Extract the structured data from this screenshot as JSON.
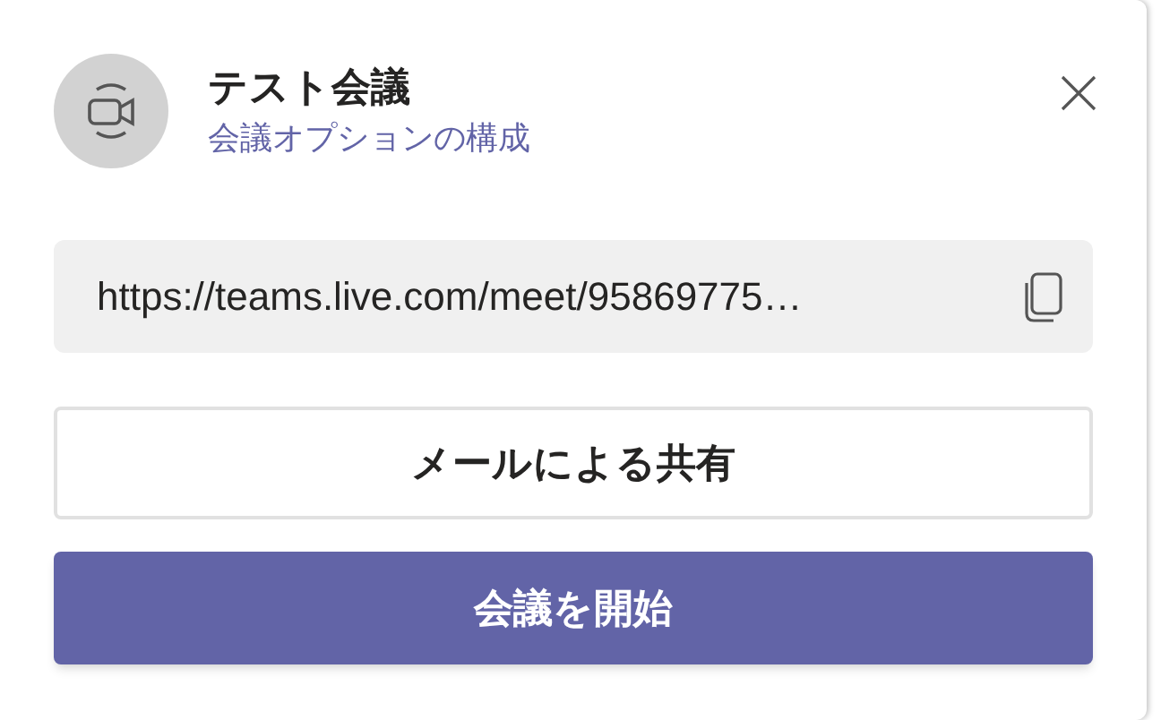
{
  "dialog": {
    "title": "テスト会議",
    "subtitle": "会議オプションの構成"
  },
  "link": {
    "value": "https://teams.live.com/meet/95869775…"
  },
  "buttons": [
    {
      "label": "メールによる共有",
      "kind": "secondary"
    },
    {
      "label": "会議を開始",
      "kind": "primary"
    }
  ]
}
